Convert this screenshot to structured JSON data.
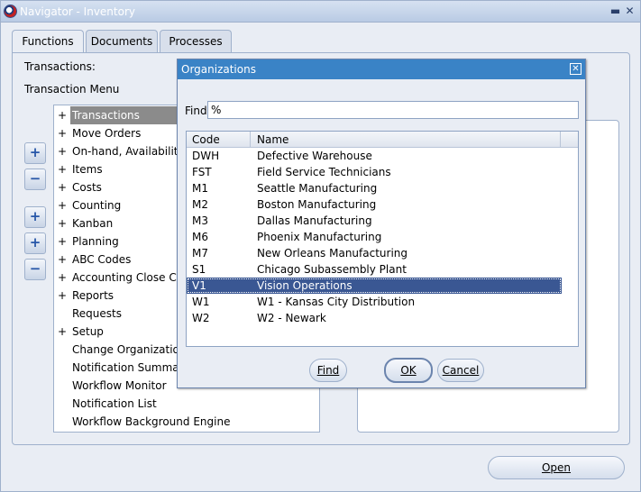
{
  "window": {
    "title": "Navigator - Inventory",
    "minimize_glyph": "▬",
    "close_glyph": "✕"
  },
  "tabs": [
    {
      "label": "Functions"
    },
    {
      "label": "Documents"
    },
    {
      "label": "Processes"
    }
  ],
  "functions": {
    "transactions_label": "Transactions:",
    "menu_label": "Transaction Menu",
    "tree": [
      {
        "prefix": "+",
        "label": "Transactions",
        "selected": true
      },
      {
        "prefix": "+",
        "label": "Move Orders"
      },
      {
        "prefix": "+",
        "label": "On-hand, Availability"
      },
      {
        "prefix": "+",
        "label": "Items"
      },
      {
        "prefix": "+",
        "label": "Costs"
      },
      {
        "prefix": "+",
        "label": "Counting"
      },
      {
        "prefix": "+",
        "label": "Kanban"
      },
      {
        "prefix": "+",
        "label": "Planning"
      },
      {
        "prefix": "+",
        "label": "ABC Codes"
      },
      {
        "prefix": "+",
        "label": "Accounting Close Cycle"
      },
      {
        "prefix": "+",
        "label": "Reports"
      },
      {
        "prefix": "",
        "label": "Requests"
      },
      {
        "prefix": "+",
        "label": "Setup"
      },
      {
        "prefix": "",
        "label": "Change Organization"
      },
      {
        "prefix": "",
        "label": "Notification Summary"
      },
      {
        "prefix": "",
        "label": "Workflow Monitor"
      },
      {
        "prefix": "",
        "label": "Notification List"
      },
      {
        "prefix": "",
        "label": "Workflow Background Engine"
      }
    ],
    "side_buttons": {
      "expand": "+",
      "collapse": "−",
      "expand_branch": "+",
      "expand_all": "+",
      "collapse_all": "−"
    },
    "open_button": "Open"
  },
  "dialog": {
    "title": "Organizations",
    "close_glyph": "✕",
    "find_label": "Find",
    "find_value": "%",
    "columns": [
      "Code",
      "Name"
    ],
    "rows": [
      {
        "code": "DWH",
        "name": "Defective Warehouse"
      },
      {
        "code": "FST",
        "name": "Field Service Technicians"
      },
      {
        "code": "M1",
        "name": "Seattle Manufacturing"
      },
      {
        "code": "M2",
        "name": "Boston Manufacturing"
      },
      {
        "code": "M3",
        "name": "Dallas Manufacturing"
      },
      {
        "code": "M6",
        "name": "Phoenix Manufacturing"
      },
      {
        "code": "M7",
        "name": "New Orleans Manufacturing"
      },
      {
        "code": "S1",
        "name": "Chicago Subassembly Plant"
      },
      {
        "code": "V1",
        "name": "Vision Operations",
        "selected": true
      },
      {
        "code": "W1",
        "name": "W1 - Kansas City Distribution"
      },
      {
        "code": "W2",
        "name": "W2 - Newark"
      }
    ],
    "buttons": {
      "find": "Find",
      "ok": "OK",
      "cancel": "Cancel"
    }
  }
}
